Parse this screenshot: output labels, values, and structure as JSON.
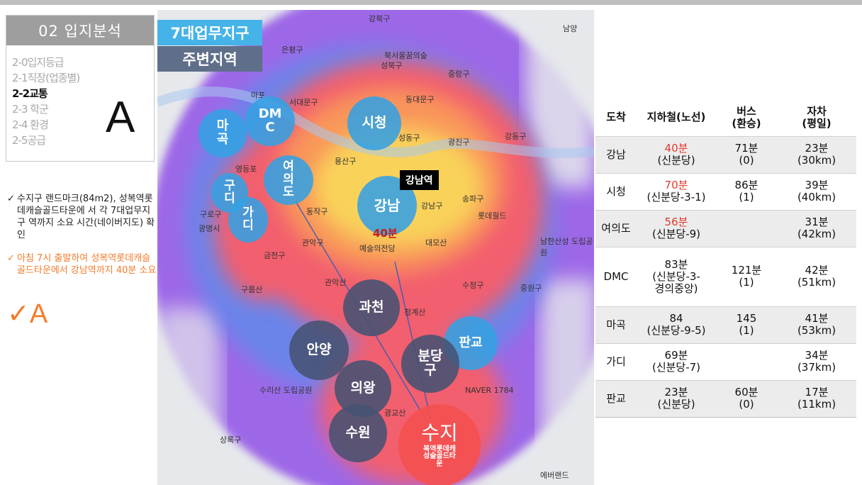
{
  "section": {
    "header": "02 입지분석",
    "items": [
      "2-0입지등급",
      "2-1직장(업종별)",
      "2-2교통",
      "2-3 학군",
      "2-4 환경",
      "2-5공급"
    ],
    "current_index": 2,
    "grade": "A"
  },
  "notes": [
    "수지구 랜드마크(84m2), 성복역롯데캐슬골드타운에 서 각 7대업무지구 역까지 소요 시간(네이버지도) 확인",
    "아침 7시 출발하여 성복역롯데캐슬골드타운에서 강남역까지 40분 소요"
  ],
  "grade_mark": "✓A",
  "map": {
    "legend_primary": "7대업무지구",
    "legend_secondary": "주변지역",
    "bubbles": [
      {
        "id": "mapo",
        "label": "마\n곡",
        "kind": "blue"
      },
      {
        "id": "dmc",
        "label": "DM\nC",
        "kind": "blue"
      },
      {
        "id": "sicheong",
        "label": "시청",
        "kind": "blue"
      },
      {
        "id": "yeouido",
        "label": "여\n의\n도",
        "kind": "blue"
      },
      {
        "id": "gudi",
        "label": "구\n디",
        "kind": "blue"
      },
      {
        "id": "gadi",
        "label": "가\n디",
        "kind": "blue"
      },
      {
        "id": "gangnam",
        "label": "강남",
        "kind": "blue"
      },
      {
        "id": "pangyo",
        "label": "판교",
        "kind": "blue"
      },
      {
        "id": "gwacheon",
        "label": "과천",
        "kind": "navy"
      },
      {
        "id": "anyang",
        "label": "안양",
        "kind": "navy"
      },
      {
        "id": "bundang",
        "label": "분당\n구",
        "kind": "navy"
      },
      {
        "id": "uiwang",
        "label": "의왕",
        "kind": "navy"
      },
      {
        "id": "suwon",
        "label": "수원",
        "kind": "navy"
      },
      {
        "id": "suji",
        "label": "수지",
        "kind": "red",
        "sub": "복역롯데캐\n성슬골드타\n운"
      }
    ],
    "station_tag": "강남역",
    "time_tag": "40분",
    "place_labels": [
      "강북구",
      "은평구",
      "성북구",
      "중랑구",
      "서대문구",
      "동대문구",
      "성동구",
      "광진구",
      "강동구",
      "용산구",
      "동작구",
      "송파구",
      "강남구",
      "구로구",
      "관악구",
      "수정구",
      "중원구",
      "상록구",
      "남양",
      "북서울꿈의숲",
      "예술의전당",
      "대모산",
      "남한산성 도립공원",
      "관악산",
      "청계산",
      "구름산",
      "수리산 도립공원",
      "광교산",
      "NAVER 1784",
      "에버랜드",
      "롯데월드",
      "금천구",
      "광명시",
      "영등포",
      "마포"
    ]
  },
  "table": {
    "headers": [
      "도착",
      "지하철(노선)",
      "버스\n(환승)",
      "자차\n(평일)"
    ],
    "rows": [
      {
        "dest": "강남",
        "subway_time": "40분",
        "subway_route": "(신분당)",
        "subway_red": true,
        "bus": "71분\n(0)",
        "car": "23분\n(30km)",
        "shade": true
      },
      {
        "dest": "시청",
        "subway_time": "70분",
        "subway_route": "(신분당-3-1)",
        "subway_red": true,
        "bus": "86분\n(1)",
        "car": "39분\n(40km)",
        "shade": false
      },
      {
        "dest": "여의도",
        "subway_time": "56분",
        "subway_route": "(신분당-9)",
        "subway_red": true,
        "bus": "",
        "car": "31분\n(42km)",
        "shade": true
      },
      {
        "dest": "DMC",
        "subway_time": "83분",
        "subway_route": "(신분당-3-\n경의중앙)",
        "subway_red": false,
        "bus": "121분\n(1)",
        "car": "42분\n(51km)",
        "shade": false
      },
      {
        "dest": "마곡",
        "subway_time": "84",
        "subway_route": "(신분당-9-5)",
        "subway_red": false,
        "bus": "145\n(1)",
        "car": "41분\n(53km)",
        "shade": true
      },
      {
        "dest": "가디",
        "subway_time": "69분",
        "subway_route": "(신분당-7)",
        "subway_red": false,
        "bus": "",
        "car": "34분\n(37km)",
        "shade": false
      },
      {
        "dest": "판교",
        "subway_time": "23분",
        "subway_route": "(신분당)",
        "subway_red": false,
        "bus": "60분\n(0)",
        "car": "17분\n(11km)",
        "shade": true
      }
    ]
  }
}
